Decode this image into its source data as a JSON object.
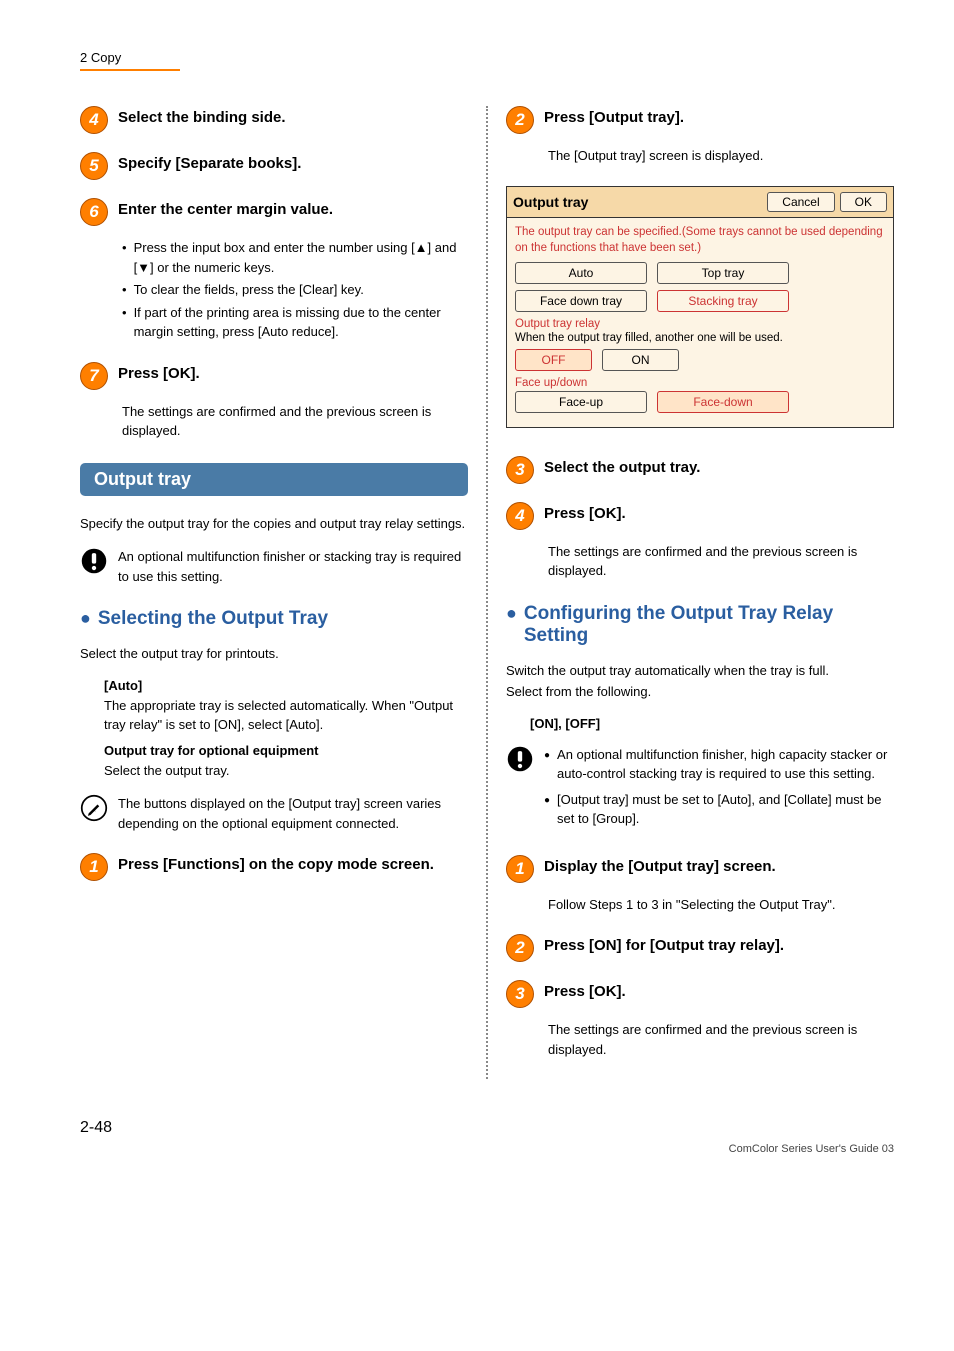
{
  "header": {
    "breadcrumb": "2 Copy"
  },
  "left": {
    "step4": {
      "title": "Select the binding side."
    },
    "step5": {
      "title": "Specify [Separate books]."
    },
    "step6": {
      "title": "Enter the center margin value.",
      "bullets": [
        "Press the input box and enter the number using [▲] and [▼] or the numeric keys.",
        "To clear the fields, press the [Clear] key.",
        "If part of the printing area is missing due to the center margin setting, press [Auto reduce]."
      ]
    },
    "step7": {
      "title": "Press [OK].",
      "body": "The settings are confirmed and the previous screen is displayed."
    },
    "section": "Output tray",
    "section_intro": "Specify the output tray for the copies and output tray relay settings.",
    "section_note": "An optional multifunction finisher or stacking tray is required to use this setting.",
    "subheading1": "Selecting the Output Tray",
    "sub1_intro": "Select the output tray for printouts.",
    "defn_auto_title": "[Auto]",
    "defn_auto_body": "The appropriate tray is selected automatically. When \"Output tray relay\" is set to [ON], select [Auto].",
    "defn_opt_title": "Output tray for optional equipment",
    "defn_opt_body": "Select the output tray.",
    "tip_note": "The buttons displayed on the [Output tray] screen varies depending on the optional equipment connected.",
    "step1": {
      "title": "Press [Functions] on the copy mode screen."
    }
  },
  "right": {
    "step2a": {
      "title": "Press [Output tray].",
      "body": "The [Output tray] screen is displayed."
    },
    "shot": {
      "title": "Output tray",
      "cancel": "Cancel",
      "ok": "OK",
      "msg": "The output tray can be specified.(Some trays cannot be used depending on the functions that have been set.)",
      "opt_auto": "Auto",
      "opt_top": "Top tray",
      "opt_fdt": "Face down tray",
      "opt_stk": "Stacking tray",
      "relay_label": "Output tray relay",
      "relay_msg": "When the output tray filled, another one will be used.",
      "off": "OFF",
      "on": "ON",
      "face_label": "Face up/down",
      "faceup": "Face-up",
      "facedown": "Face-down"
    },
    "step3a": {
      "title": "Select the output tray."
    },
    "step4a": {
      "title": "Press [OK].",
      "body": "The settings are confirmed and the previous screen is displayed."
    },
    "subheading2": "Configuring the Output Tray Relay Setting",
    "sub2_intro1": "Switch the output tray automatically when the tray is full.",
    "sub2_intro2": "Select from the following.",
    "sub2_opts": "[ON], [OFF]",
    "sub2_notes": [
      "An optional multifunction finisher, high capacity stacker or auto-control stacking tray is required to use this setting.",
      "[Output tray] must be set to [Auto], and [Collate] must be set to [Group]."
    ],
    "step1b": {
      "title": "Display the [Output tray] screen.",
      "body": "Follow Steps 1 to 3 in \"Selecting the Output Tray\"."
    },
    "step2b": {
      "title": "Press [ON] for [Output tray relay]."
    },
    "step3b": {
      "title": "Press [OK].",
      "body": "The settings are confirmed and the previous screen is displayed."
    }
  },
  "footer": {
    "pagenum": "2-48",
    "line": "ComColor Series User's Guide 03"
  }
}
